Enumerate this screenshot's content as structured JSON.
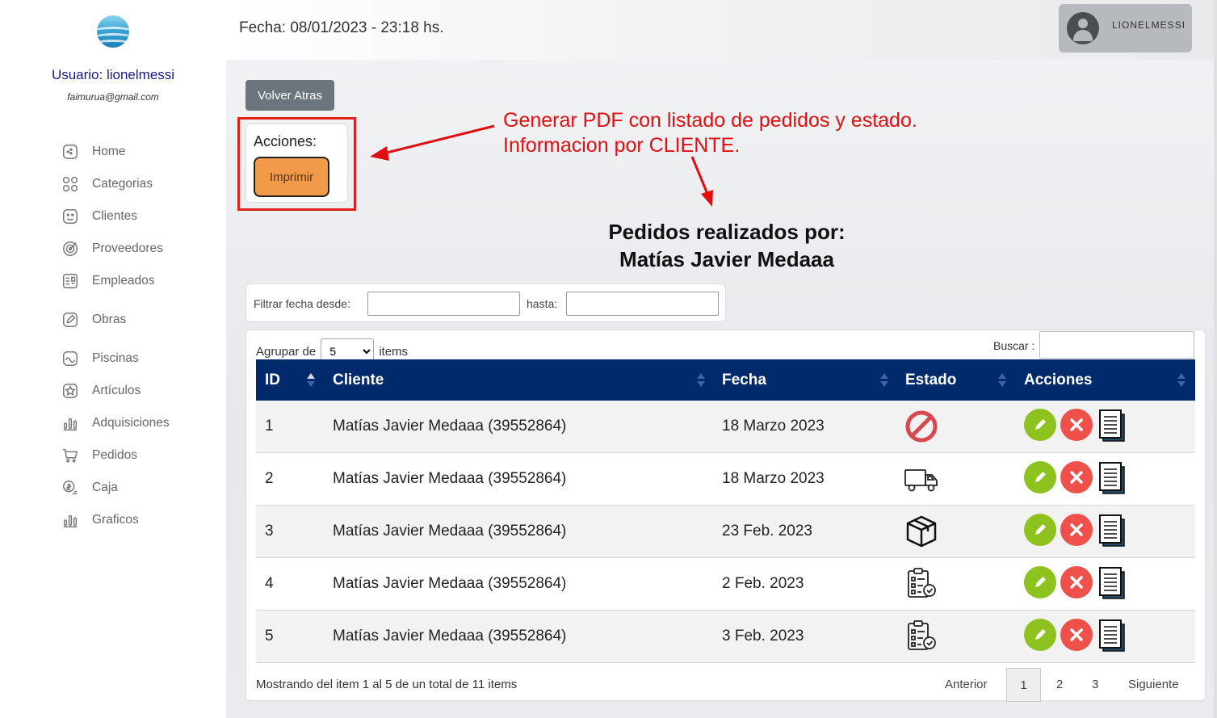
{
  "sidebar": {
    "user_label": "Usuario: lionelmessi",
    "email": "faimurua@gmail.com",
    "items": [
      {
        "label": "Home",
        "icon": "home-icon"
      },
      {
        "label": "Categorias",
        "icon": "categories-icon"
      },
      {
        "label": "Clientes",
        "icon": "clients-icon"
      },
      {
        "label": "Proveedores",
        "icon": "suppliers-icon"
      },
      {
        "label": "Empleados",
        "icon": "employees-icon"
      },
      {
        "label": "Obras",
        "icon": "edit-icon"
      },
      {
        "label": "Piscinas",
        "icon": "wave-icon"
      },
      {
        "label": "Artículos",
        "icon": "star-icon"
      },
      {
        "label": "Adquisiciones",
        "icon": "bar-chart-icon"
      },
      {
        "label": "Pedidos",
        "icon": "cart-icon"
      },
      {
        "label": "Caja",
        "icon": "cash-icon"
      },
      {
        "label": "Graficos",
        "icon": "bar-chart-icon"
      }
    ]
  },
  "header": {
    "fecha": "Fecha: 08/01/2023 - 23:18 hs.",
    "username": "LIONELMESSI"
  },
  "actions": {
    "volver": "Volver Atras",
    "acciones_title": "Acciones:",
    "imprimir": "Imprimir"
  },
  "annotation": {
    "line1": "Generar PDF con listado de pedidos y estado.",
    "line2": "Informacion por CLIENTE."
  },
  "heading": {
    "line1": "Pedidos realizados por:",
    "line2": "Matías Javier Medaaa"
  },
  "filter": {
    "desde_label": "Filtrar fecha desde:",
    "hasta_label": "hasta:"
  },
  "table": {
    "agrupar_label": "Agrupar de",
    "agrupar_value": "5",
    "items_label": "items",
    "buscar_label": "Buscar :",
    "columns": [
      "ID",
      "Cliente",
      "Fecha",
      "Estado",
      "Acciones"
    ],
    "rows": [
      {
        "id": "1",
        "cliente": "Matías Javier Medaaa (39552864)",
        "fecha": "18 Marzo 2023",
        "estado_icon": "cancelled-icon"
      },
      {
        "id": "2",
        "cliente": "Matías Javier Medaaa (39552864)",
        "fecha": "18 Marzo 2023",
        "estado_icon": "truck-icon"
      },
      {
        "id": "3",
        "cliente": "Matías Javier Medaaa (39552864)",
        "fecha": "23 Feb. 2023",
        "estado_icon": "box-icon"
      },
      {
        "id": "4",
        "cliente": "Matías Javier Medaaa (39552864)",
        "fecha": "2 Feb. 2023",
        "estado_icon": "checklist-icon"
      },
      {
        "id": "5",
        "cliente": "Matías Javier Medaaa (39552864)",
        "fecha": "3 Feb. 2023",
        "estado_icon": "checklist-icon"
      }
    ],
    "footer_info": "Mostrando del item 1 al 5 de un total de 11 items",
    "pagination": {
      "prev": "Anterior",
      "pages": [
        "1",
        "2",
        "3"
      ],
      "next": "Siguiente",
      "active_page": "1"
    }
  },
  "colors": {
    "table_header": "#002a6b",
    "edit_button": "#8dc21f",
    "delete_button": "#f0504a",
    "imprimir_button": "#f09a4a",
    "annotation": "#e01010"
  }
}
